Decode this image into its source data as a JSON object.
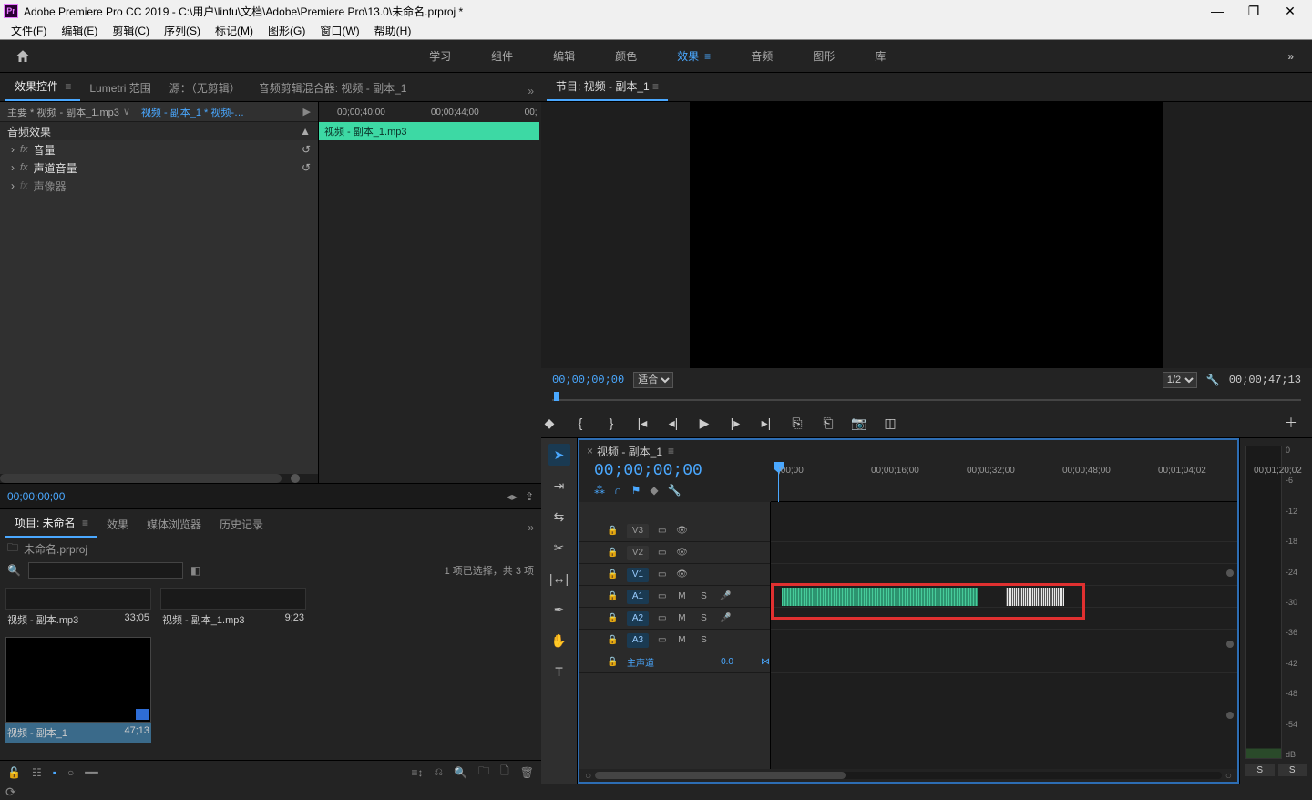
{
  "titlebar": {
    "logo": "Pr",
    "title": "Adobe Premiere Pro CC 2019 - C:\\用户\\linfu\\文档\\Adobe\\Premiere Pro\\13.0\\未命名.prproj *"
  },
  "menu": [
    "文件(F)",
    "编辑(E)",
    "剪辑(C)",
    "序列(S)",
    "标记(M)",
    "图形(G)",
    "窗口(W)",
    "帮助(H)"
  ],
  "workspaces": {
    "items": [
      "学习",
      "组件",
      "编辑",
      "颜色",
      "效果",
      "音频",
      "图形",
      "库"
    ],
    "active": "效果",
    "overflow": "»"
  },
  "ecTabs": {
    "items": [
      "效果控件",
      "Lumetri 范围",
      "源：（无剪辑）",
      "音频剪辑混合器: 视频 - 副本_1"
    ],
    "active": 0
  },
  "ecHeader": {
    "master": "主要 * 视频 - 副本_1.mp3",
    "chev": "∨",
    "sub": "视频 - 副本_1 * 视频-…"
  },
  "ecRuler": [
    "00;00;40;00",
    "00;00;44;00",
    "00;"
  ],
  "ecClip": "视频 - 副本_1.mp3",
  "ecRows": {
    "section": "音频效果",
    "r1": "音量",
    "r2": "声道音量",
    "r3": "声像器"
  },
  "ecTC": "00;00;00;00",
  "projectTabs": {
    "items": [
      "项目: 未命名",
      "效果",
      "媒体浏览器",
      "历史记录"
    ],
    "active": 0
  },
  "project": {
    "file": "未命名.prproj",
    "info": "1 项已选择，共 3 项",
    "clips": [
      {
        "name": "视频 - 副本.mp3",
        "dur": "33;05"
      },
      {
        "name": "视频 - 副本_1.mp3",
        "dur": "9;23"
      }
    ],
    "seq": {
      "name": "视频 - 副本_1",
      "dur": "47;13"
    }
  },
  "program": {
    "tab": "节目: 视频 - 副本_1",
    "tcLeft": "00;00;00;00",
    "fit": "适合",
    "res": "1/2",
    "tcRight": "00;00;47;13"
  },
  "timeline": {
    "tab": "视频 - 副本_1",
    "tc": "00;00;00;00",
    "ruler": [
      ";00;00",
      "00;00;16;00",
      "00;00;32;00",
      "00;00;48;00",
      "00;01;04;02",
      "00;01;20;02"
    ],
    "vtracks": [
      "V3",
      "V2",
      "V1"
    ],
    "atracks": [
      "A1",
      "A2",
      "A3"
    ],
    "master": "主声道",
    "masterVal": "0.0"
  },
  "meters": {
    "labels": [
      "0",
      "-6",
      "-12",
      "-18",
      "-24",
      "-30",
      "-36",
      "-42",
      "-48",
      "-54",
      "dB"
    ],
    "solo": "S"
  }
}
